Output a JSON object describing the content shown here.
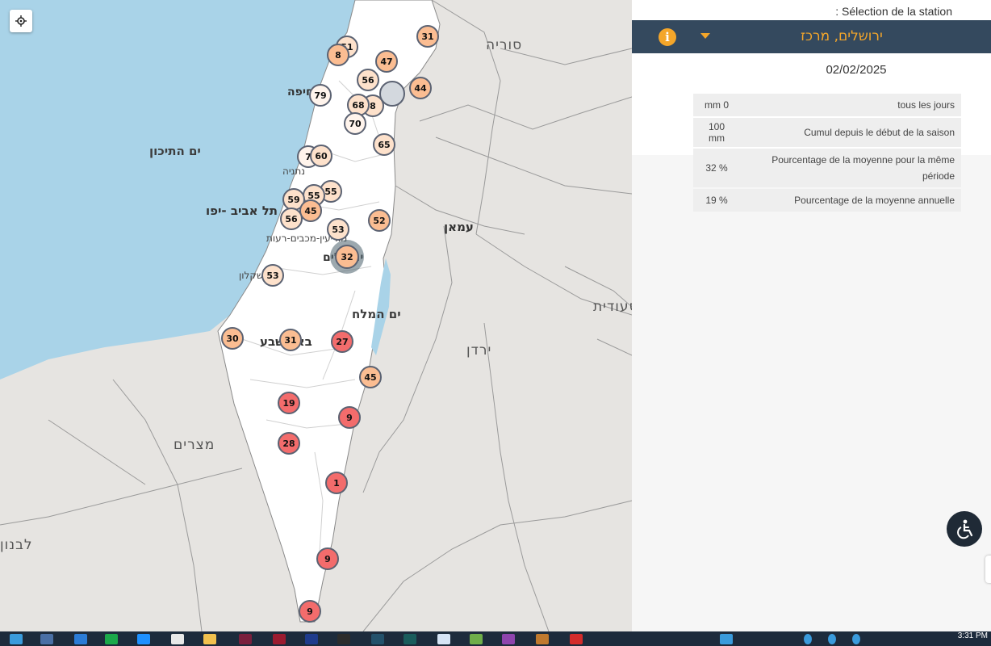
{
  "map": {
    "labels": {
      "syria": "סוריה",
      "mediterranean": "ים התיכון",
      "haifa": "חיפה",
      "netanya": "נתניה",
      "tel_aviv": "תל אביב -יפו",
      "modiin": "מודיעין-מכבים-רעות",
      "jerusalem": "ירושלים",
      "amman": "עמאן",
      "ashkelon": "אשקלון",
      "dead_sea": "ים המלח",
      "beersheba": "באר שבע",
      "jordan": "ירדן",
      "egypt": "מצרים",
      "saudi": "סעודית",
      "leb": "לבנון"
    },
    "markers": [
      {
        "value": "31",
        "style": "peach"
      },
      {
        "value": "51",
        "style": "light"
      },
      {
        "value": "8",
        "style": "peach"
      },
      {
        "value": "47",
        "style": "peach"
      },
      {
        "value": "56",
        "style": "light"
      },
      {
        "value": "44",
        "style": "peach"
      },
      {
        "value": "",
        "style": "grey"
      },
      {
        "value": "79",
        "style": "pale"
      },
      {
        "value": "8",
        "style": "light"
      },
      {
        "value": "68",
        "style": "light"
      },
      {
        "value": "70",
        "style": "pale"
      },
      {
        "value": "65",
        "style": "light"
      },
      {
        "value": "7",
        "style": "pale"
      },
      {
        "value": "60",
        "style": "light"
      },
      {
        "value": "55",
        "style": "light"
      },
      {
        "value": "55",
        "style": "light"
      },
      {
        "value": "59",
        "style": "light"
      },
      {
        "value": "45",
        "style": "peach"
      },
      {
        "value": "56",
        "style": "light"
      },
      {
        "value": "53",
        "style": "light"
      },
      {
        "value": "52",
        "style": "peach"
      },
      {
        "value": "32",
        "style": "peach"
      },
      {
        "value": "53",
        "style": "light"
      },
      {
        "value": "30",
        "style": "peach"
      },
      {
        "value": "31",
        "style": "peach"
      },
      {
        "value": "27",
        "style": "red"
      },
      {
        "value": "45",
        "style": "peach"
      },
      {
        "value": "19",
        "style": "red"
      },
      {
        "value": "9",
        "style": "red"
      },
      {
        "value": "28",
        "style": "red"
      },
      {
        "value": "1",
        "style": "red"
      },
      {
        "value": "9",
        "style": "red"
      },
      {
        "value": "9",
        "style": "red"
      }
    ]
  },
  "panel": {
    "selection_label": ": Sélection de la station",
    "station_name": "ירושלים, מרכז",
    "date": "02/02/2025",
    "rows": [
      {
        "value": "mm 0",
        "label": "tous les jours"
      },
      {
        "value": "100 mm",
        "label": "Cumul depuis le début de la saison"
      },
      {
        "value": "32 %",
        "label": "Pourcentage de la moyenne pour la même période"
      },
      {
        "value": "19 %",
        "label": "Pourcentage de la moyenne annuelle"
      }
    ]
  },
  "taskbar": {
    "time": "3:31 PM"
  }
}
